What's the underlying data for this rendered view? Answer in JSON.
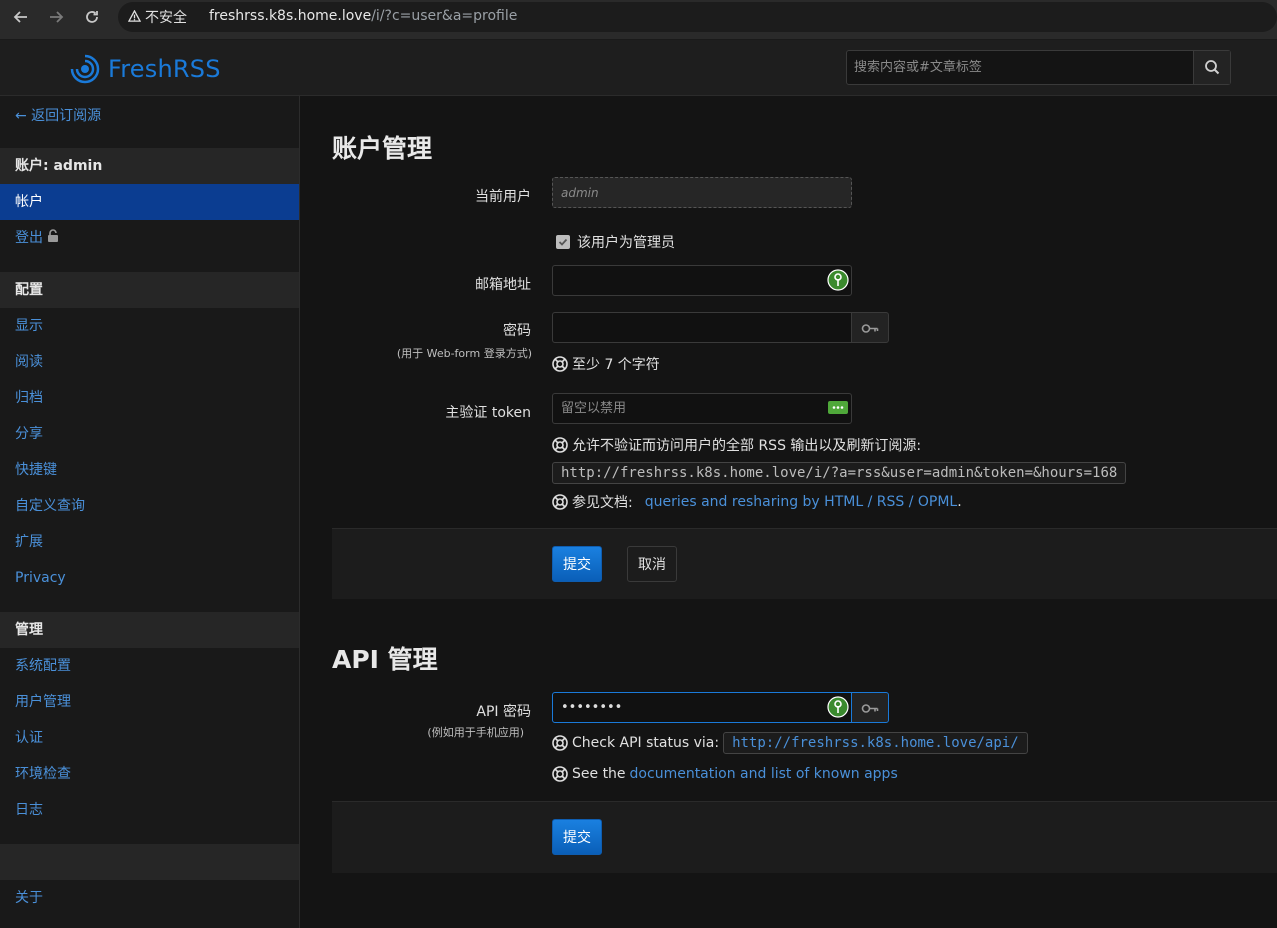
{
  "browser": {
    "security_label": "不安全",
    "url_host": "freshrss.k8s.home.love",
    "url_path": "/i/?c=user&a=profile"
  },
  "header": {
    "app_name": "FreshRSS",
    "search_placeholder": "搜索内容或#文章标签"
  },
  "sidebar": {
    "back_link": "← 返回订阅源",
    "account_section": "账户: admin",
    "account_active": "帐户",
    "logout": "登出",
    "config_section": "配置",
    "config_items": [
      "显示",
      "阅读",
      "归档",
      "分享",
      "快捷键",
      "自定义查询",
      "扩展",
      "Privacy"
    ],
    "admin_section": "管理",
    "admin_items": [
      "系统配置",
      "用户管理",
      "认证",
      "环境检查",
      "日志"
    ],
    "about": "关于"
  },
  "account": {
    "title": "账户管理",
    "current_user_label": "当前用户",
    "current_user_value": "admin",
    "is_admin_label": "该用户为管理员",
    "email_label": "邮箱地址",
    "email_value": "",
    "password_label": "密码",
    "password_sublabel": "(用于 Web-form 登录方式)",
    "password_hint": "至少 7 个字符",
    "token_label": "主验证 token",
    "token_placeholder": "留空以禁用",
    "token_help": "允许不验证而访问用户的全部 RSS 输出以及刷新订阅源:",
    "token_url": "http://freshrss.k8s.home.love/i/?a=rss&user=admin&token=&hours=168",
    "docs_prefix": "参见文档:",
    "docs_link": "queries and resharing by HTML / RSS / OPML",
    "docs_suffix": ".",
    "submit": "提交",
    "cancel": "取消"
  },
  "api": {
    "title": "API 管理",
    "password_label": "API 密码",
    "password_sublabel": "(例如用于手机应用)",
    "password_value": "••••••••",
    "status_prefix": "Check API status via:",
    "status_url": "http://freshrss.k8s.home.love/api/",
    "see_prefix": "See the",
    "see_link": "documentation and list of known apps",
    "submit": "提交"
  },
  "colors": {
    "accent": "#1a7ad9",
    "link": "#4a90d9",
    "active_bg": "#0b3d91"
  }
}
